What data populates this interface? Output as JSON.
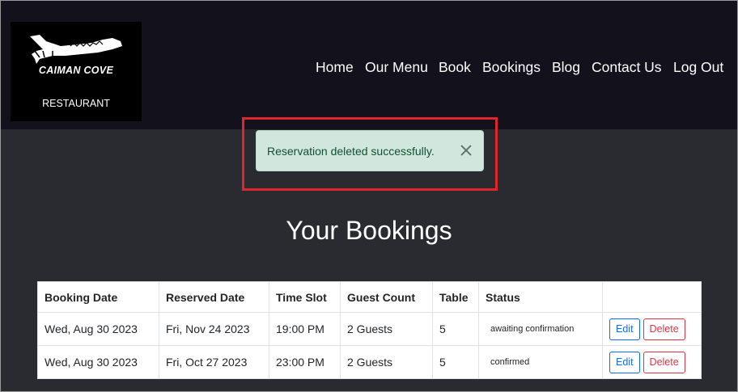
{
  "logo": {
    "name": "CAIMAN COVE",
    "subtitle": "RESTAURANT"
  },
  "nav": {
    "items": [
      "Home",
      "Our Menu",
      "Book",
      "Bookings",
      "Blog",
      "Contact Us",
      "Log Out"
    ]
  },
  "alert": {
    "message": "Reservation deleted successfully.",
    "close_icon": "close-icon"
  },
  "page": {
    "title": "Your Bookings"
  },
  "table": {
    "headers": [
      "Booking Date",
      "Reserved Date",
      "Time Slot",
      "Guest Count",
      "Table",
      "Status",
      ""
    ],
    "rows": [
      {
        "booking_date": "Wed, Aug 30 2023",
        "reserved_date": "Fri, Nov 24 2023",
        "time_slot": "19:00 PM",
        "guest_count": "2 Guests",
        "table": "5",
        "status": "awaiting confirmation",
        "edit": "Edit",
        "delete": "Delete"
      },
      {
        "booking_date": "Wed, Aug 30 2023",
        "reserved_date": "Fri, Oct 27 2023",
        "time_slot": "23:00 PM",
        "guest_count": "2 Guests",
        "table": "5",
        "status": "confirmed",
        "edit": "Edit",
        "delete": "Delete"
      }
    ]
  },
  "colors": {
    "header_bg": "#12111c",
    "body_bg": "#292b30",
    "alert_bg": "#d1e7dd",
    "alert_text": "#0f5132",
    "highlight": "#e0262b",
    "edit": "#0d6efd",
    "delete": "#dc3545"
  }
}
